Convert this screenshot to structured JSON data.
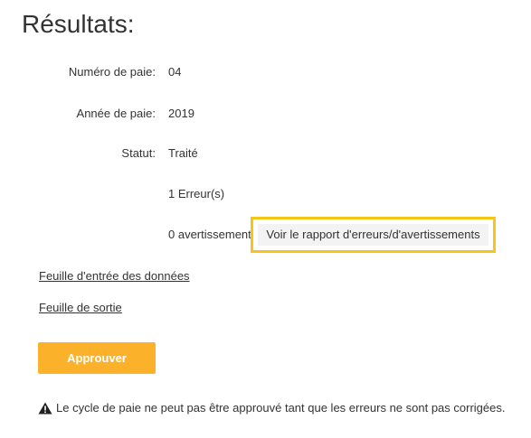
{
  "page": {
    "title": "Résultats:"
  },
  "fields": {
    "pay_number_label": "Numéro de paie:",
    "pay_number_value": "04",
    "pay_year_label": "Année de paie:",
    "pay_year_value": "2019",
    "status_label": "Statut:",
    "status_value": "Traité",
    "errors_text": "1 Erreur(s)",
    "warnings_text": "0 avertissements"
  },
  "actions": {
    "report_button_label": "Voir le rapport d'erreurs/d'avertissements",
    "data_entry_sheet_link": "Feuille d'entrée des données",
    "output_sheet_link": "Feuille de sortie",
    "approve_button_label": "Approuver"
  },
  "notice": {
    "icon": "warning-icon",
    "text": "Le cycle de paie ne peut pas être approuvé tant que les erreurs ne sont pas corrigées."
  },
  "colors": {
    "accent": "#fbb22a",
    "highlight": "#f5c518"
  }
}
